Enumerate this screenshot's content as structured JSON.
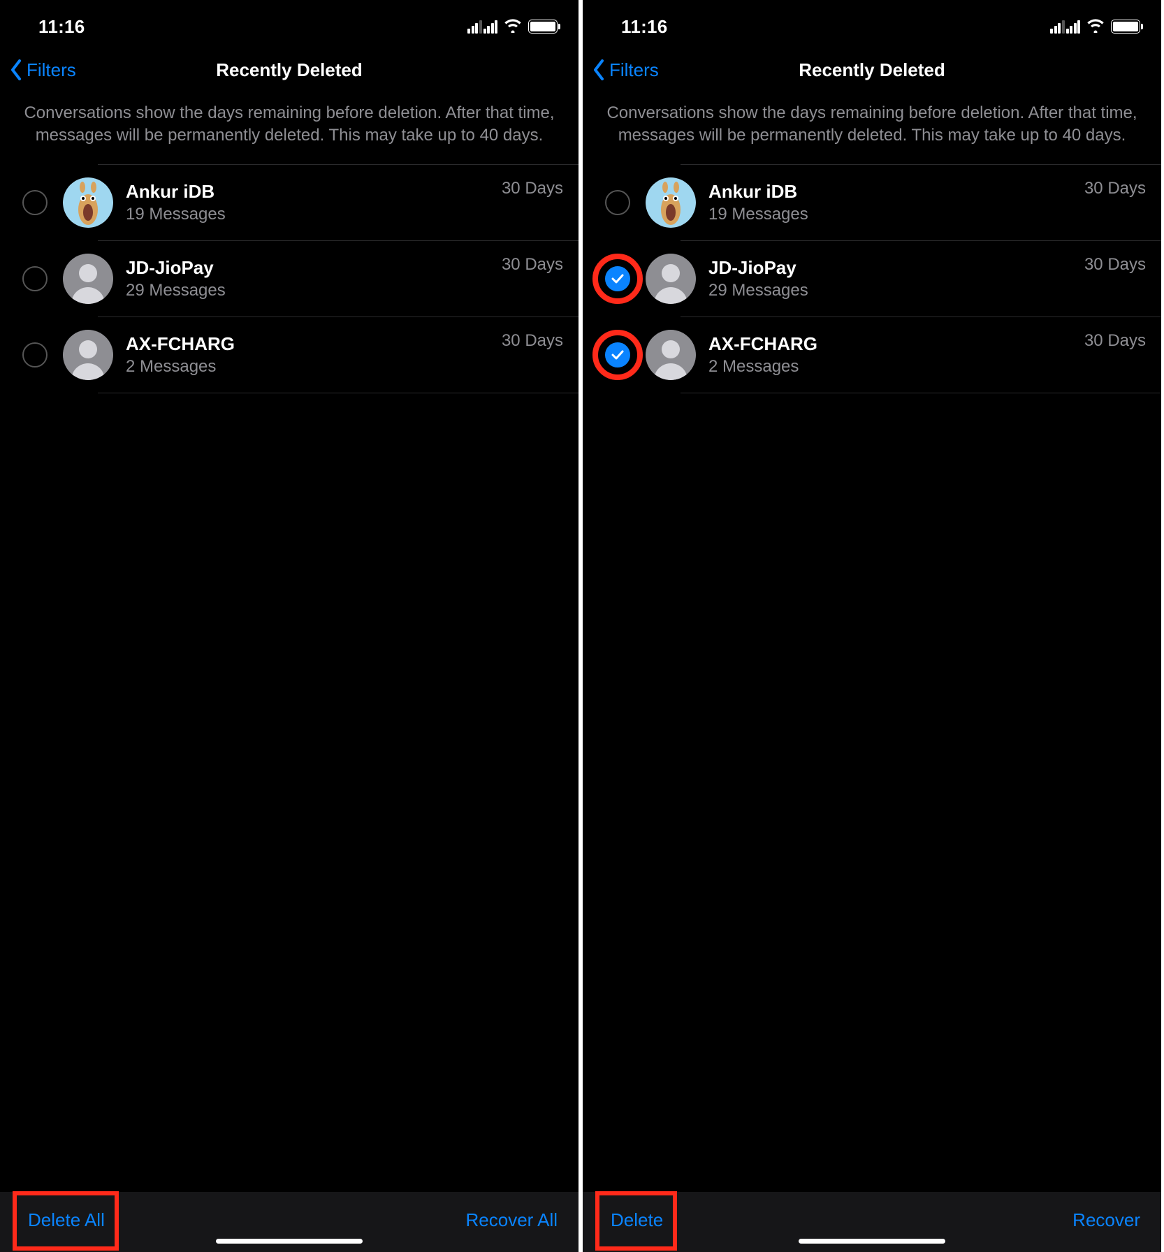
{
  "status": {
    "time": "11:16"
  },
  "nav": {
    "back_label": "Filters",
    "title": "Recently Deleted"
  },
  "info": "Conversations show the days remaining before deletion. After that time, messages will be permanently deleted. This may take up to 40 days.",
  "conversations": [
    {
      "name": "Ankur iDB",
      "sub": "19 Messages",
      "days": "30 Days",
      "avatar": "photo"
    },
    {
      "name": "JD-JioPay",
      "sub": "29 Messages",
      "days": "30 Days",
      "avatar": "default"
    },
    {
      "name": "AX-FCHARG",
      "sub": "2 Messages",
      "days": "30 Days",
      "avatar": "default"
    }
  ],
  "left_toolbar": {
    "delete": "Delete All",
    "recover": "Recover All"
  },
  "right_toolbar": {
    "delete": "Delete",
    "recover": "Recover"
  },
  "right_selected": [
    false,
    true,
    true
  ]
}
